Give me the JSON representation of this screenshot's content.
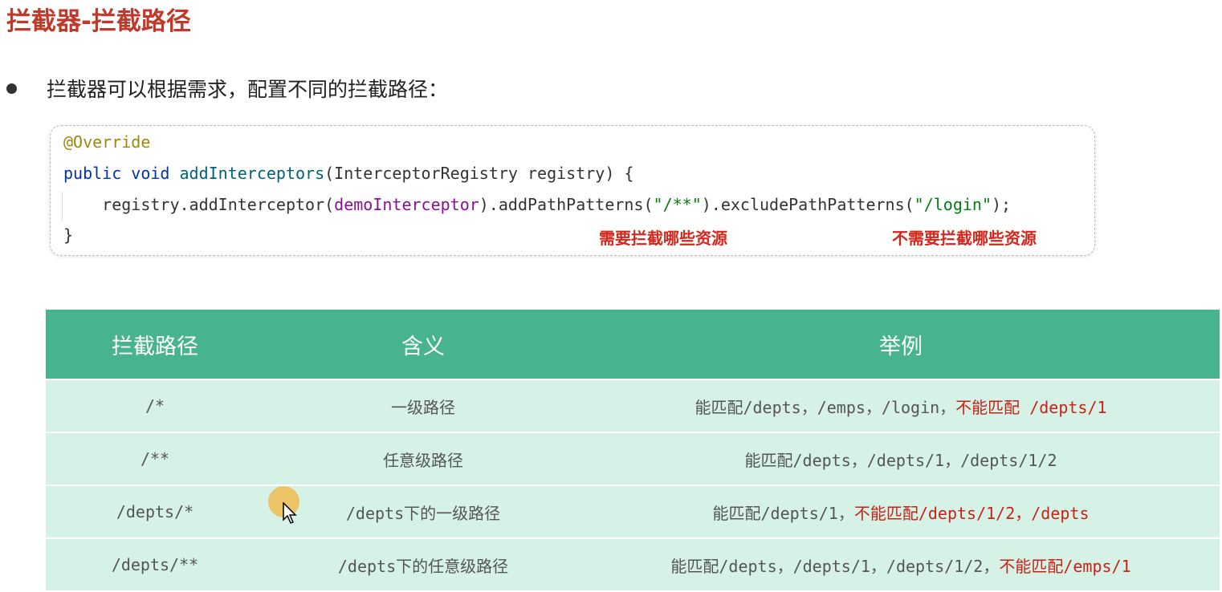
{
  "title": "拦截器-拦截路径",
  "bullet": "拦截器可以根据需求，配置不同的拦截路径：",
  "code": {
    "annotation": "@Override",
    "signature": {
      "kw1": "public",
      "kw2": "void",
      "method": "addInterceptors",
      "params": "(InterceptorRegistry registry) {"
    },
    "body": {
      "prefix": "    registry.addInterceptor(",
      "field": "demoInterceptor",
      "middle": ").addPathPatterns(",
      "str1": "\"/**\"",
      "middle2": ").excludePathPatterns(",
      "str2": "\"/login\"",
      "suffix": ");"
    },
    "close": "}",
    "note_include": "需要拦截哪些资源",
    "note_exclude": "不需要拦截哪些资源"
  },
  "table": {
    "headers": [
      "拦截路径",
      "含义",
      "举例"
    ],
    "rows": [
      {
        "path": "/*",
        "meaning": "一级路径",
        "example": "能匹配/depts，/emps，/login，",
        "example_red": "不能匹配 /depts/1"
      },
      {
        "path": "/**",
        "meaning": "任意级路径",
        "example": "能匹配/depts，/depts/1，/depts/1/2",
        "example_red": ""
      },
      {
        "path": "/depts/*",
        "meaning": "/depts下的一级路径",
        "example": "能匹配/depts/1，",
        "example_red": "不能匹配/depts/1/2，/depts"
      },
      {
        "path": "/depts/**",
        "meaning": "/depts下的任意级路径",
        "example": "能匹配/depts，/depts/1，/depts/1/2，",
        "example_red": "不能匹配/emps/1"
      }
    ]
  },
  "colors": {
    "title": "#c0392b",
    "header_bg": "#47b48e",
    "row_bg": "#d6f2e6",
    "highlight_red": "#c62216"
  }
}
